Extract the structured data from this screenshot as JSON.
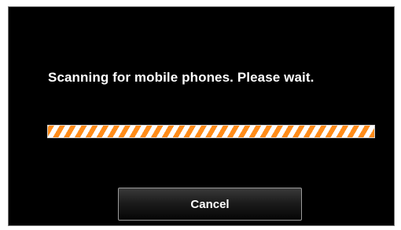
{
  "dialog": {
    "message": "Scanning for mobile phones. Please wait.",
    "progress": {
      "style": "indeterminate",
      "stripe_colors": [
        "#ff8c1a",
        "#ffffff"
      ]
    },
    "cancel_label": "Cancel"
  },
  "colors": {
    "background": "#000000",
    "text": "#ffffff",
    "accent": "#ff8c1a"
  }
}
